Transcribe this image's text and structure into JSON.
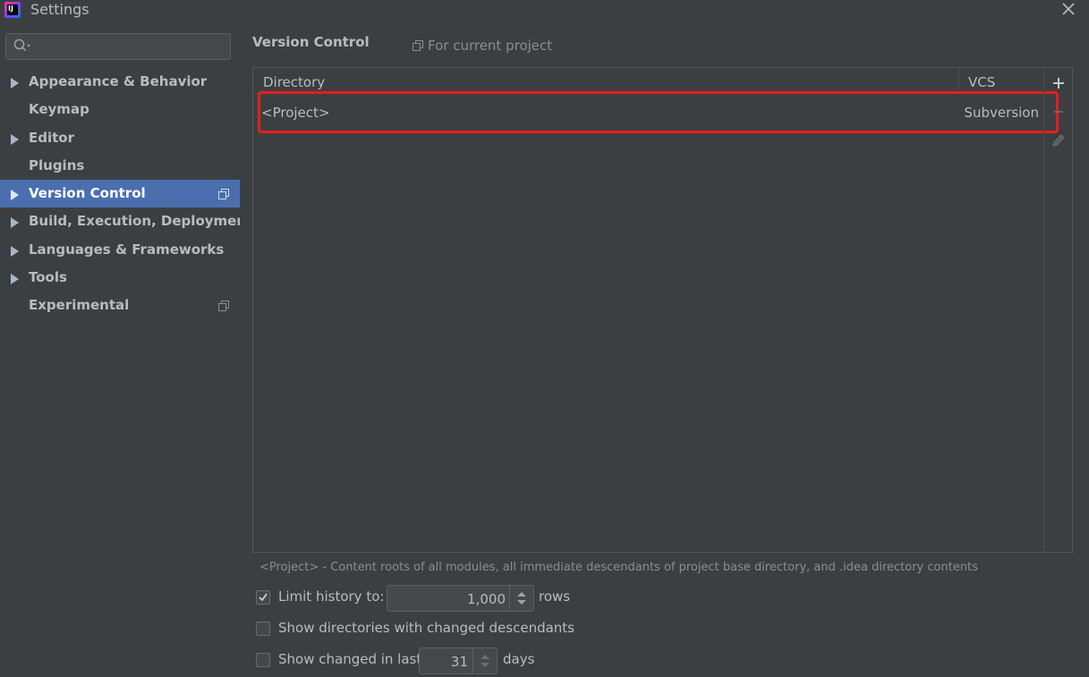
{
  "window": {
    "title": "Settings",
    "app_icon": "intellij-idea-icon",
    "app_icon_text": "IJ"
  },
  "sidebar": {
    "search": {
      "placeholder": "",
      "value": ""
    },
    "items": [
      {
        "label": "Appearance & Behavior",
        "expandable": true,
        "selected": false,
        "project_scope": false
      },
      {
        "label": "Keymap",
        "expandable": false,
        "selected": false,
        "project_scope": false
      },
      {
        "label": "Editor",
        "expandable": true,
        "selected": false,
        "project_scope": false
      },
      {
        "label": "Plugins",
        "expandable": false,
        "selected": false,
        "project_scope": false
      },
      {
        "label": "Version Control",
        "expandable": true,
        "selected": true,
        "project_scope": true
      },
      {
        "label": "Build, Execution, Deployment",
        "expandable": true,
        "selected": false,
        "project_scope": false
      },
      {
        "label": "Languages & Frameworks",
        "expandable": true,
        "selected": false,
        "project_scope": false
      },
      {
        "label": "Tools",
        "expandable": true,
        "selected": false,
        "project_scope": false
      },
      {
        "label": "Experimental",
        "expandable": false,
        "selected": false,
        "project_scope": true
      }
    ]
  },
  "content": {
    "title": "Version Control",
    "scope_label": "For current project",
    "table": {
      "columns": [
        "Directory",
        "VCS"
      ],
      "rows": [
        {
          "directory": "<Project>",
          "vcs": "Subversion"
        }
      ],
      "toolbar": [
        "add-icon",
        "remove-icon",
        "edit-icon"
      ]
    },
    "hint": "<Project> - Content roots of all modules, all immediate descendants of project base directory, and .idea directory contents",
    "options": {
      "limit_history": {
        "label": "Limit history to:",
        "checked": true,
        "value": "1,000",
        "suffix": "rows"
      },
      "show_directories": {
        "label": "Show directories with changed descendants",
        "checked": false
      },
      "show_changed": {
        "label": "Show changed in last",
        "checked": false,
        "value": "31",
        "suffix": "days"
      }
    }
  },
  "colors": {
    "background": "#3c3f41",
    "selection": "#4b6eaf",
    "highlight_box": "#e51e1e",
    "text": "#bbbbbb"
  }
}
